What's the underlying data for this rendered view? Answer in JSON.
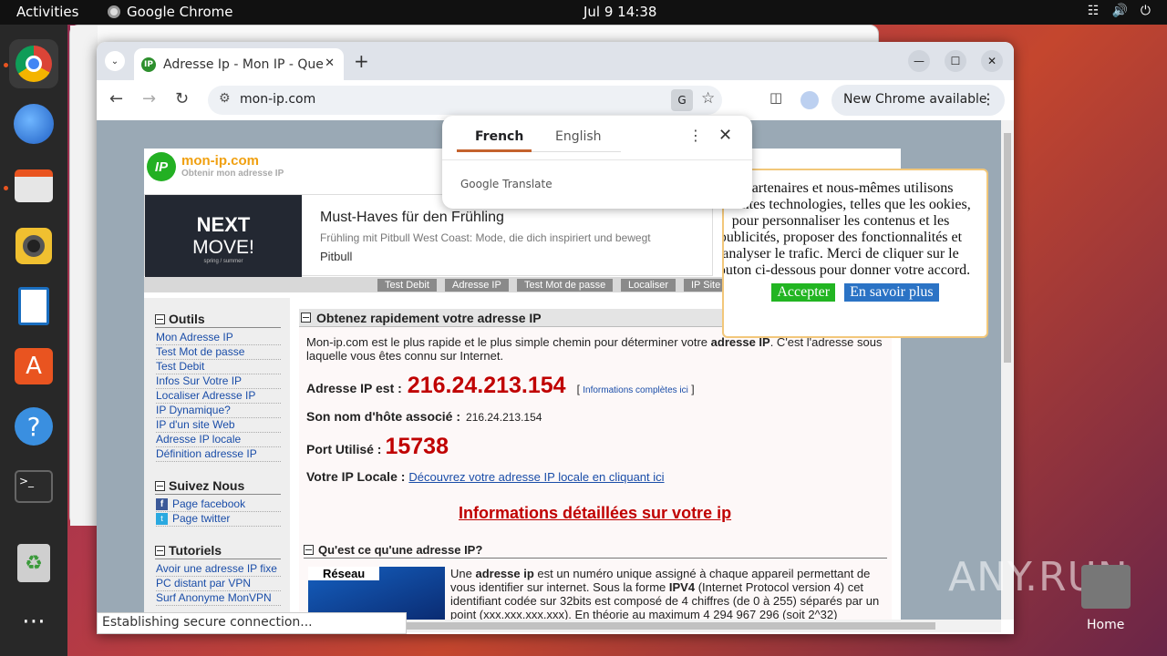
{
  "topbar": {
    "activities": "Activities",
    "app_name": "Google Chrome",
    "clock": "Jul 9  14:38"
  },
  "dock": {
    "items": [
      "chrome-icon",
      "thunderbird-icon",
      "files-icon",
      "rhythmbox-icon",
      "writer-icon",
      "software-icon",
      "help-icon",
      "terminal-icon",
      "trash-icon",
      "apps-grid-icon"
    ]
  },
  "browser": {
    "tab_title": "Adresse Ip - Mon IP - Que",
    "url": "mon-ip.com",
    "new_chrome": "New Chrome available",
    "status": "Establishing secure connection..."
  },
  "translate": {
    "lang_from": "French",
    "lang_to": "English",
    "brand": "Google Translate"
  },
  "site": {
    "name": "mon-ip.com",
    "tagline": "Obtenir mon adresse IP",
    "logo_text": "IP",
    "ad": {
      "img_line1": "NEXT",
      "img_line2": "MOVE!",
      "img_line3": "spring / summer",
      "title": "Must-Haves für den Frühling",
      "desc": "Frühling mit Pitbull West Coast: Mode, die dich inspiriert und bewegt",
      "brand": "Pitbull"
    },
    "nav": [
      "Test Debit",
      "Adresse IP",
      "Test Mot de passe",
      "Localiser",
      "IP Site"
    ],
    "sidebar": {
      "outils_title": "Outils",
      "outils": [
        "Mon Adresse IP",
        "Test Mot de passe",
        "Test Debit",
        "Infos Sur Votre IP",
        "Localiser Adresse IP",
        "IP Dynamique?",
        "IP d'un site Web",
        "Adresse IP locale",
        "Définition adresse IP"
      ],
      "suivez_title": "Suivez Nous",
      "suivez": [
        "Page facebook",
        "Page twitter"
      ],
      "tuto_title": "Tutoriels",
      "tutoriels": [
        "Avoir une adresse IP fixe",
        "PC distant par VPN",
        "Surf Anonyme MonVPN"
      ]
    },
    "main": {
      "title": "Obtenez rapidement votre adresse IP",
      "intro_a": "Mon-ip.com est le plus rapide et le plus simple chemin pour déterminer votre ",
      "intro_b": "adresse IP",
      "intro_c": ". C'est l'adresse sous laquelle vous êtes connu sur Internet.",
      "ip_label": "Adresse IP est :",
      "ip": "216.24.213.154",
      "info_link": "Informations complètes ici",
      "host_label": "Son nom d'hôte associé :",
      "host": "216.24.213.154",
      "port_label": "Port Utilisé :",
      "port": "15738",
      "local_label": "Votre IP Locale :",
      "local_link": "Découvrez votre adresse IP locale en cliquant ici",
      "details_link": "Informations détaillées sur votre ip",
      "q_title": "Qu'est ce qu'une adresse IP?",
      "reseau": "Réseau",
      "q_text_a": "Une ",
      "q_text_b": "adresse ip",
      "q_text_c": " est un numéro unique assigné à chaque appareil permettant de vous identifier sur internet. Sous la forme ",
      "q_text_d": "IPV4",
      "q_text_e": " (Internet Protocol version 4) cet identifiant codée sur 32bits est composé de 4 chiffres (de 0 à 255) séparés par un point (xxx.xxx.xxx.xxx). En théorie au maximum 4 294 967 296 (soit 2^32)"
    },
    "cookie": {
      "text": "os partenaires et nous-mêmes utilisons ifférentes technologies, telles que les ookies, pour personnaliser les contenus et les publicités, proposer des fonctionnalités et analyser le trafic. Merci de cliquer sur le bouton ci-dessous pour donner votre accord.",
      "accept": "Accepter",
      "more": "En savoir plus"
    }
  },
  "desktop": {
    "watermark": "ANY.RUN",
    "home_label": "Home"
  }
}
